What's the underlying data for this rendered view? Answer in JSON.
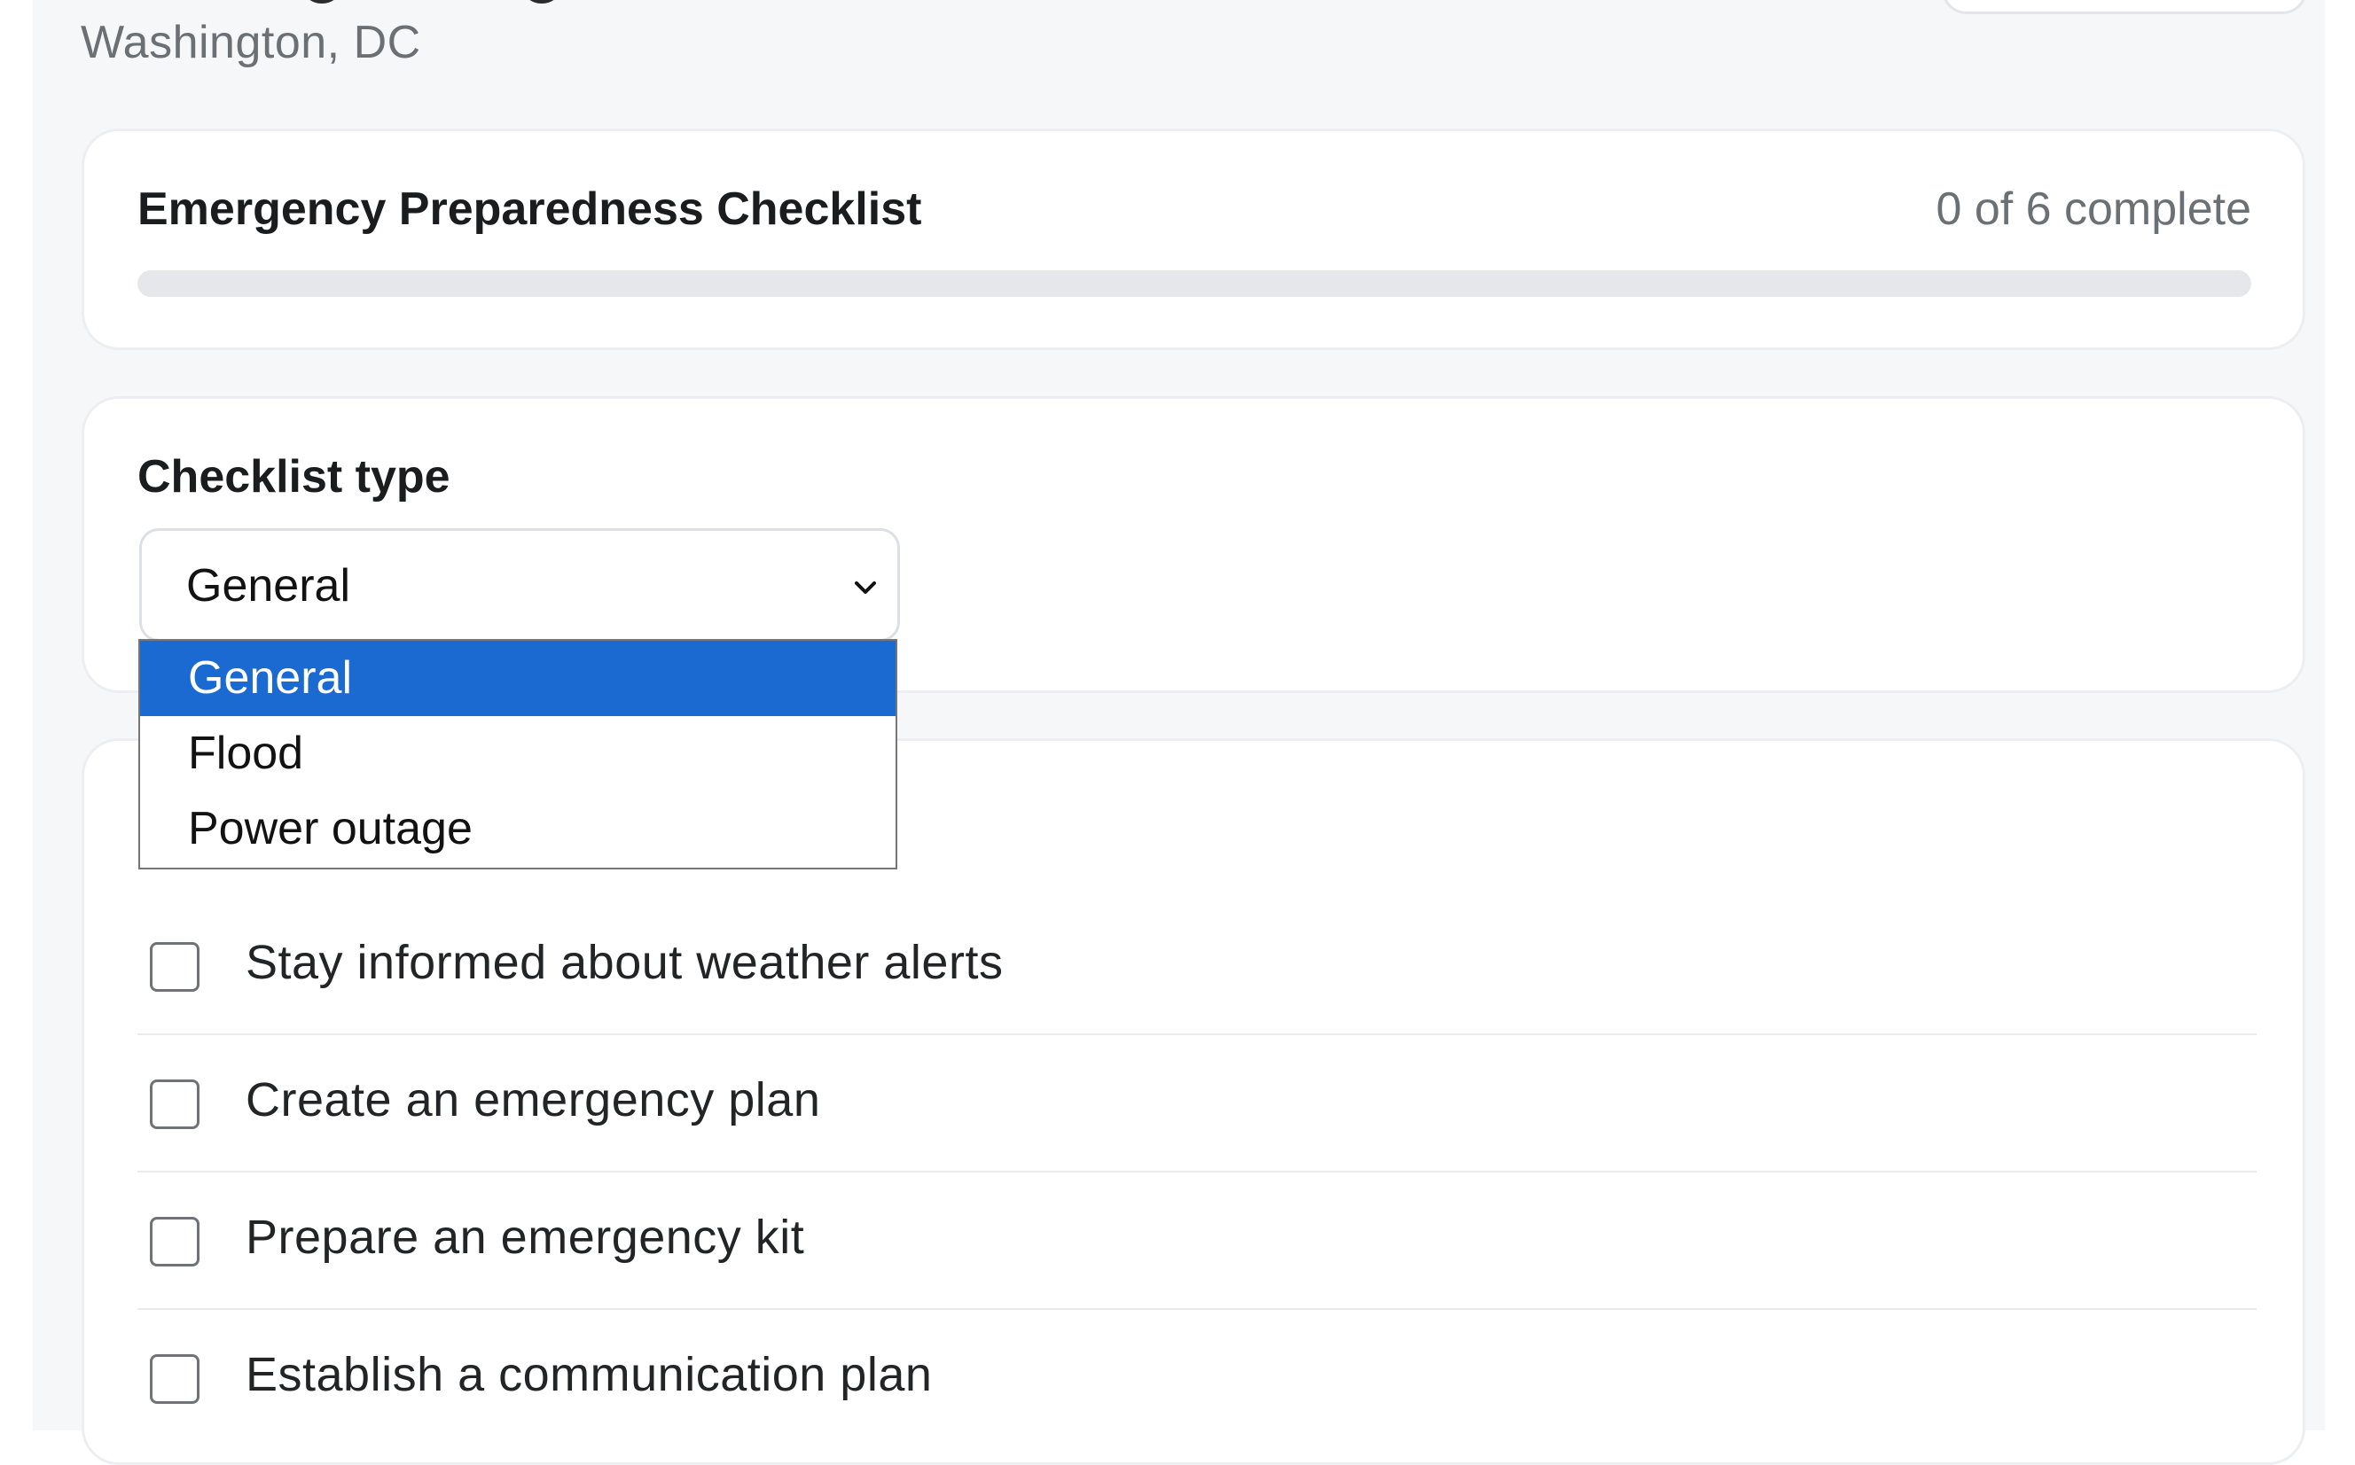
{
  "header": {
    "location": "Washington, DC"
  },
  "progress_card": {
    "title": "Emergency Preparedness Checklist",
    "status": "0 of 6 complete",
    "completed_fraction": 0,
    "accent_color": "#1766d6"
  },
  "type_card": {
    "label": "Checklist type",
    "selected": "General",
    "options": [
      "General",
      "Flood",
      "Power outage"
    ]
  },
  "checklist": {
    "items": [
      {
        "label": "Stay informed about weather alerts",
        "checked": false
      },
      {
        "label": "Create an emergency plan",
        "checked": false
      },
      {
        "label": "Prepare an emergency kit",
        "checked": false
      },
      {
        "label": "Establish a communication plan",
        "checked": false
      }
    ]
  },
  "icons": {
    "select_chevron": "chevron-down-icon"
  },
  "colors": {
    "selected_option_bg": "#1b6ad2",
    "page_background": "#f6f7f9"
  }
}
